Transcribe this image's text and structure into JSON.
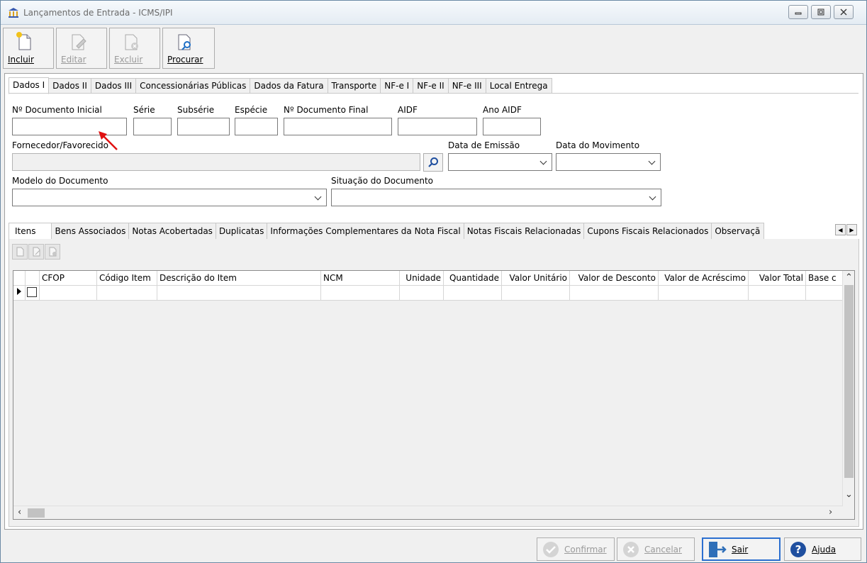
{
  "window": {
    "title": "Lançamentos de Entrada - ICMS/IPI"
  },
  "toolbar": {
    "incluir": "Incluir",
    "editar": "Editar",
    "excluir": "Excluir",
    "procurar": "Procurar"
  },
  "top_tabs": [
    "Dados I",
    "Dados II",
    "Dados III",
    "Concessionárias Públicas",
    "Dados da Fatura",
    "Transporte",
    "NF-e I",
    "NF-e II",
    "NF-e III",
    "Local Entrega"
  ],
  "form": {
    "nro_doc_inicial": "Nº Documento Inicial",
    "serie": "Série",
    "subserie": "Subsérie",
    "especie": "Espécie",
    "nro_doc_final": "Nº Documento Final",
    "aidf": "AIDF",
    "ano_aidf": "Ano AIDF",
    "fornecedor": "Fornecedor/Favorecido",
    "data_emissao": "Data de Emissão",
    "data_movimento": "Data do Movimento",
    "modelo_documento": "Modelo do Documento",
    "situacao_documento": "Situação do Documento"
  },
  "bottom_tabs": [
    "Itens",
    "Bens Associados",
    "Notas Acobertadas",
    "Duplicatas",
    "Informações Complementares da Nota Fiscal",
    "Notas Fiscais Relacionadas",
    "Cupons Fiscais Relacionados",
    "Observaçã"
  ],
  "grid": {
    "columns": [
      "CFOP",
      "Código Item",
      "Descrição do Item",
      "NCM",
      "Unidade",
      "Quantidade",
      "Valor Unitário",
      "Valor de Desconto",
      "Valor de Acréscimo",
      "Valor Total",
      "Base c"
    ]
  },
  "footer": {
    "confirmar": "Confirmar",
    "cancelar": "Cancelar",
    "sair": "Sair",
    "ajuda": "Ajuda"
  },
  "colors": {
    "focus_blue": "#2b6fd0",
    "annotation_arrow": "#e01010"
  }
}
